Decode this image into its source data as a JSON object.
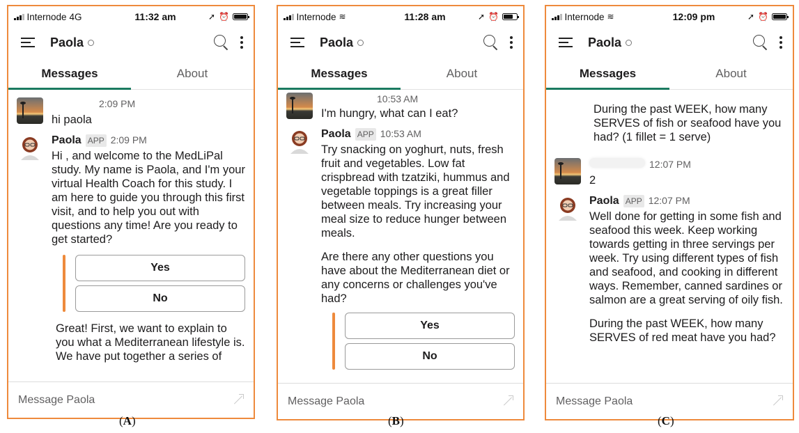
{
  "colors": {
    "frame": "#ee8a3c",
    "tab_indicator": "#1b7a60",
    "attachment_bar": "#ee8a3c"
  },
  "panels": [
    {
      "caption": "A",
      "status": {
        "carrier": "Internode",
        "network": "4G",
        "time": "11:32 am"
      },
      "header": {
        "title": "Paola"
      },
      "tabs": [
        "Messages",
        "About"
      ],
      "messages": [
        {
          "time": "2:09 PM",
          "text": [
            "hi paola"
          ]
        },
        {
          "sender": "Paola",
          "badge": "APP",
          "time": "2:09 PM",
          "text": [
            "Hi , and welcome to the MedLiPal study. My name is Paola, and I'm your virtual Health Coach for this study. I am here to guide you through this first visit, and to help you out with questions any time! Are you ready to get started?"
          ]
        }
      ],
      "buttons": [
        "Yes",
        "No"
      ],
      "after": [
        "Great! First, we want to explain to you what a Mediterranean lifestyle is. We have put together a series of"
      ],
      "composer_placeholder": "Message Paola"
    },
    {
      "caption": "B",
      "status": {
        "carrier": "Internode",
        "time": "11:28 am"
      },
      "header": {
        "title": "Paola"
      },
      "tabs": [
        "Messages",
        "About"
      ],
      "messages": [
        {
          "time": "10:53 AM",
          "text": [
            "I'm hungry, what can I eat?"
          ]
        },
        {
          "sender": "Paola",
          "badge": "APP",
          "time": "10:53 AM",
          "text": [
            "Try snacking on yoghurt, nuts, fresh fruit and vegetables. Low fat crispbread with tzatziki, hummus and vegetable toppings is a great filler between meals. Try increasing your meal size to reduce hunger between meals.",
            "Are there any other questions you have about the Mediterranean diet or any concerns or challenges you've had?"
          ]
        }
      ],
      "buttons": [
        "Yes",
        "No"
      ],
      "composer_placeholder": "Message Paola"
    },
    {
      "caption": "C",
      "status": {
        "carrier": "Internode",
        "time": "12:09 pm"
      },
      "header": {
        "title": "Paola"
      },
      "tabs": [
        "Messages",
        "About"
      ],
      "intro": "During the past WEEK, how many SERVES of fish or seafood have you had? (1 fillet = 1 serve)",
      "messages": [
        {
          "time": "12:07 PM",
          "text": [
            "2"
          ]
        },
        {
          "sender": "Paola",
          "badge": "APP",
          "time": "12:07 PM",
          "text": [
            "Well done for getting in some fish and seafood this week. Keep working towards getting in three servings per week. Try using different types of fish and seafood, and cooking in different ways. Remember, canned sardines or salmon are a great serving of oily fish.",
            "During the past WEEK, how many SERVES of red meat have you had?"
          ]
        }
      ],
      "composer_placeholder": "Message Paola"
    }
  ]
}
